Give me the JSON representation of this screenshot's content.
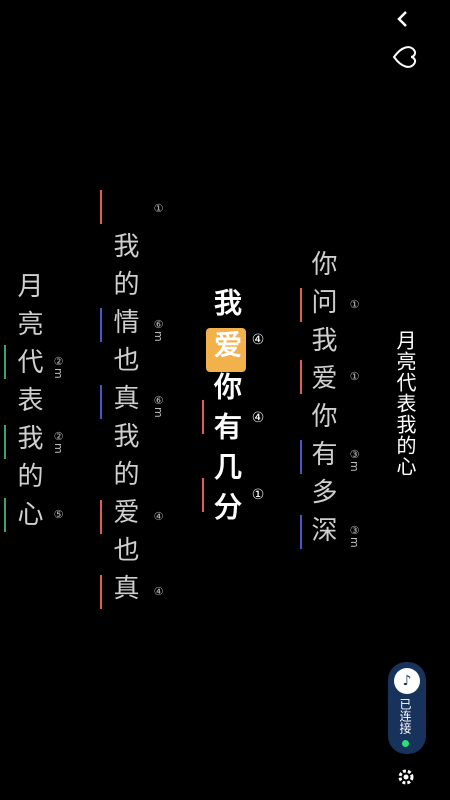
{
  "header": {
    "back_icon": "back-arrow-icon",
    "favorite_icon": "heart-icon"
  },
  "song": {
    "title": "月亮代表我的心"
  },
  "lyrics": {
    "line1": [
      "你",
      "问",
      "我",
      "爱",
      "你",
      "有",
      "多",
      "深"
    ],
    "line2": [
      "我",
      "爱",
      "你",
      "有",
      "几",
      "分"
    ],
    "line3": [
      "我",
      "的",
      "情",
      "也",
      "真",
      "我",
      "的",
      "爱",
      "也",
      "真"
    ],
    "line4": [
      "月",
      "亮",
      "代",
      "表",
      "我",
      "的",
      "心"
    ]
  },
  "chord_numbers": {
    "l1": [
      "①",
      "①",
      "③m",
      "③m"
    ],
    "l2": [
      "④",
      "④",
      "①"
    ],
    "l3": [
      "①",
      "⑥m",
      "⑥m",
      "④",
      "④"
    ],
    "l4": [
      "②m",
      "②m",
      "⑤"
    ]
  },
  "connection": {
    "status_label": "已连接",
    "status_color": "#2be07a",
    "icon": "guitar-icon"
  },
  "settings": {
    "icon": "gear-icon"
  },
  "colors": {
    "highlight": "#f2b14a",
    "mark_red": "#e05b5b",
    "mark_blue": "#4a57c8",
    "mark_green": "#3aa26a",
    "pill": "#17325b"
  }
}
